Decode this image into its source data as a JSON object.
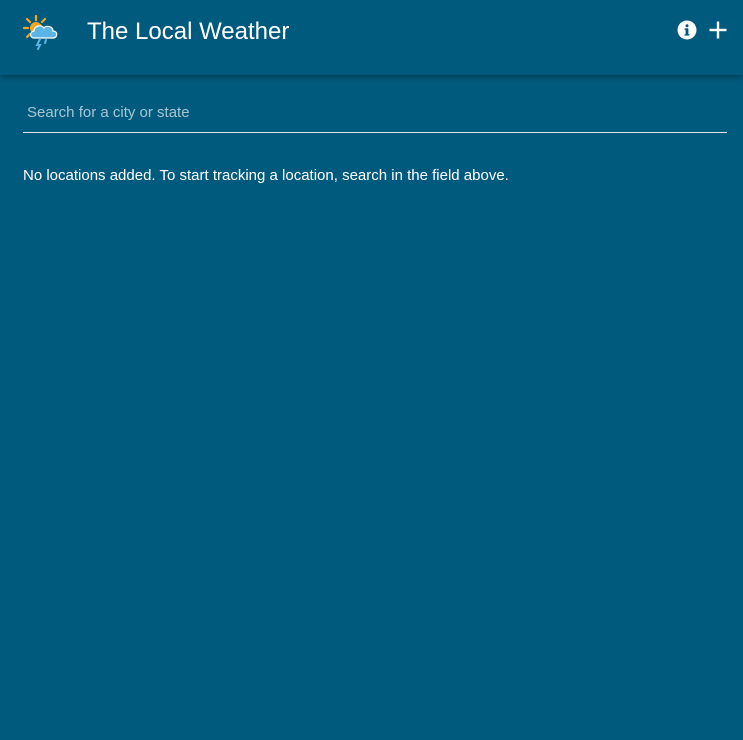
{
  "header": {
    "title": "The Local Weather",
    "logo_icon": "weather-sun-cloud-rain-icon",
    "info_icon": "info-icon",
    "add_icon": "plus-icon"
  },
  "search": {
    "placeholder": "Search for a city or state",
    "value": ""
  },
  "main": {
    "empty_message": "No locations added. To start tracking a location, search in the field above."
  },
  "colors": {
    "background": "#005a7d",
    "text": "#ffffff",
    "sun": "#f5a623",
    "cloud": "#5bb4e5"
  }
}
